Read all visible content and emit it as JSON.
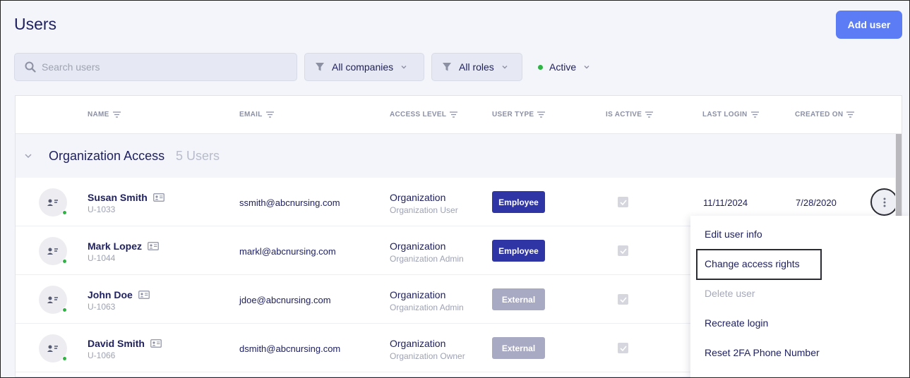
{
  "header": {
    "title": "Users",
    "add_user_label": "Add user"
  },
  "toolbar": {
    "search_placeholder": "Search users",
    "companies_filter": "All companies",
    "roles_filter": "All roles",
    "status_filter": "Active",
    "status_color": "#2fb344"
  },
  "table": {
    "columns": [
      "NAME",
      "EMAIL",
      "ACCESS LEVEL",
      "USER TYPE",
      "IS ACTIVE",
      "LAST LOGIN",
      "CREATED ON"
    ],
    "group": {
      "title": "Organization Access",
      "count": "5 Users"
    },
    "rows": [
      {
        "name": "Susan Smith",
        "id": "U-1033",
        "email": "ssmith@abcnursing.com",
        "access": "Organization",
        "access_role": "Organization User",
        "type": "Employee",
        "active": true,
        "last_login": "11/11/2024",
        "created": "7/28/2020"
      },
      {
        "name": "Mark Lopez",
        "id": "U-1044",
        "email": "markl@abcnursing.com",
        "access": "Organization",
        "access_role": "Organization Admin",
        "type": "Employee",
        "active": true,
        "last_login": "",
        "created": ""
      },
      {
        "name": "John Doe",
        "id": "U-1063",
        "email": "jdoe@abcnursing.com",
        "access": "Organization",
        "access_role": "Organization Admin",
        "type": "External",
        "active": true,
        "last_login": "",
        "created": ""
      },
      {
        "name": "David Smith",
        "id": "U-1066",
        "email": "dsmith@abcnursing.com",
        "access": "Organization",
        "access_role": "Organization Owner",
        "type": "External",
        "active": true,
        "last_login": "",
        "created": ""
      }
    ]
  },
  "menu": {
    "items": [
      {
        "label": "Edit user info",
        "disabled": false
      },
      {
        "label": "Change access rights",
        "disabled": false,
        "highlighted": true
      },
      {
        "label": "Delete user",
        "disabled": true
      },
      {
        "label": "Recreate login",
        "disabled": false
      },
      {
        "label": "Reset 2FA Phone Number",
        "disabled": false
      }
    ]
  },
  "colors": {
    "primary": "#5b7cf5",
    "employee_badge": "#2f35a5",
    "external_badge": "#a8a9c2",
    "online": "#2fb344"
  }
}
